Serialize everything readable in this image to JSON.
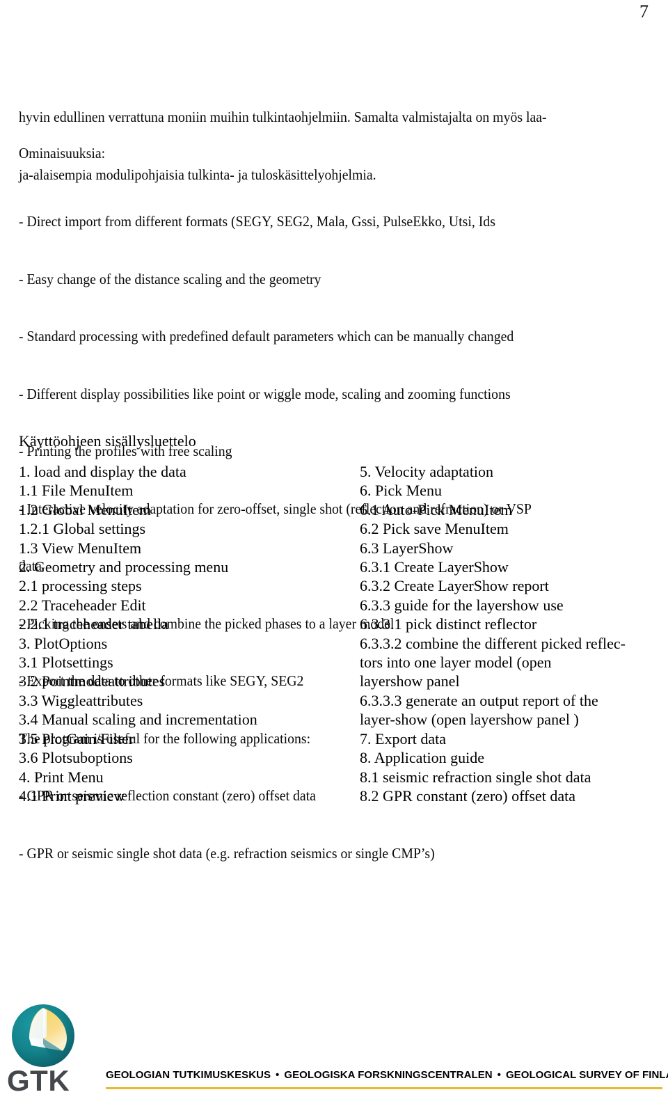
{
  "page": {
    "number": "7"
  },
  "intro": {
    "lines": [
      "hyvin edullinen verrattuna moniin muihin tulkintaohjelmiin. Samalta valmistajalta on myös laa-",
      "ja-alaisempia modulipohjaisia tulkinta- ja tuloskäsittelyohjelmia."
    ]
  },
  "features": {
    "heading": "Ominaisuuksia:",
    "lines": [
      "- Direct import from different formats (SEGY, SEG2, Mala, Gssi, PulseEkko, Utsi, Ids",
      "- Easy change of the distance scaling and the geometry",
      "- Standard processing with predefined default parameters which can be manually changed",
      "- Different display possibilities like point or wiggle mode, scaling and zooming functions",
      "- Printing the profiles with free scaling",
      "- Interactive velocity adaptation for zero-offset, single shot (reflection and refraction) or VSP",
      "data",
      "- Picking the onsets and combine the picked phases to a layer model",
      "- Export the data to other formats like SEGY, SEG2",
      "The program is useful for the following applications:",
      "- GPR or seismic reflection constant (zero) offset data",
      "- GPR or seismic single shot data (e.g. refraction seismics or single CMP’s)"
    ]
  },
  "toc": {
    "title": "Käyttöohjeen sisällysluettelo",
    "left_column": [
      "1. load and display the data",
      "1.1 File MenuItem",
      "1.2 Global MenuItem",
      "1.2.1 Global settings",
      "1.3 View MenuItem",
      "2. Geometry and processing menu",
      "2.1 processing steps",
      "2.2 Traceheader Edit",
      "2.2.1 traceheader tabella",
      "3. PlotOptions",
      "3.1 Plotsettings",
      "3.2 Pointmodeattributes",
      "3.3 Wiggleattributes",
      "3.4 Manual scaling and incrementation",
      "3.5 PlotGain/Filter",
      "3.6 Plotsuboptions",
      "4. Print Menu",
      "4.1 Print preview"
    ],
    "right_column": [
      "5. Velocity adaptation",
      "6. Pick Menu",
      "6.1 Auto-Pick MenuItem",
      "6.2 Pick save MenuItem",
      "6.3 LayerShow",
      "6.3.1 Create LayerShow",
      "6.3.2 Create LayerShow report",
      "6.3.3 guide for the layershow use",
      "6.3.3.1 pick distinct reflector",
      "6.3.3.2 combine the different picked reflec-",
      "tors into one layer model (open",
      "layershow panel",
      "6.3.3.3 generate an output report of the",
      "layer-show (open layershow panel )",
      "7. Export data",
      "8. Application guide",
      "8.1 seismic refraction single shot data",
      "8.2 GPR constant (zero) offset data"
    ]
  },
  "footer": {
    "logo_wordmark": "GTK",
    "logo_icon": "gtk-sphere-logo",
    "org_fi": "GEOLOGIAN TUTKIMUSKESKUS",
    "org_sv": "GEOLOGISKA FORSKNINGSCENTRALEN",
    "org_en": "GEOLOGICAL SURVEY OF FINLAND",
    "separator": "•",
    "rule_color": "#e8b92e",
    "logo_teal": "#147f87",
    "logo_yellow": "#f5cf4a",
    "wordmark_color": "#44474c"
  }
}
